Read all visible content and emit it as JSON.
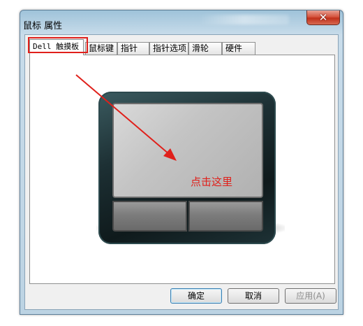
{
  "window": {
    "title": "鼠标 属性",
    "close_glyph": "✕"
  },
  "tabs": [
    {
      "label": "Dell 触摸板",
      "active": true
    },
    {
      "label": "鼠标键"
    },
    {
      "label": "指针"
    },
    {
      "label": "指针选项"
    },
    {
      "label": "滑轮"
    },
    {
      "label": "硬件"
    }
  ],
  "annotation": {
    "text": "点击这里",
    "color": "#e0201b"
  },
  "buttons": {
    "ok": "确定",
    "cancel": "取消",
    "apply": "应用(A)"
  },
  "icons": {
    "close": "close-icon",
    "arrow": "annotation-arrow"
  }
}
